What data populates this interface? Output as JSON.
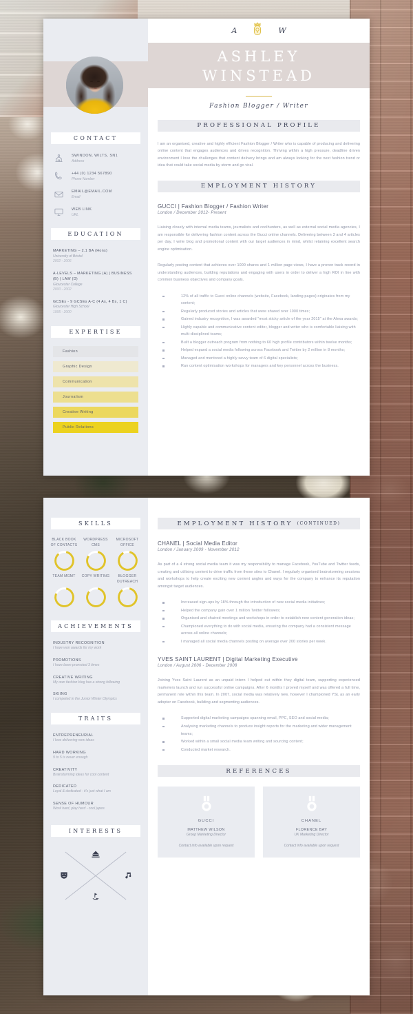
{
  "monogram": {
    "left_initial": "A",
    "right_initial": "W",
    "crest_color": "#e9c84a"
  },
  "header": {
    "first_name": "ASHLEY",
    "last_name": "WINSTEAD",
    "tagline": "Fashion Blogger / Writer",
    "band_color": "#ded6d4"
  },
  "sidebar": {
    "contact": {
      "heading": "CONTACT",
      "items": [
        {
          "icon": "location-icon",
          "value": "SWINDON, WILTS, SN1",
          "label": "Address"
        },
        {
          "icon": "phone-icon",
          "value": "+44 (0) 1234 567890",
          "label": "Phone Number"
        },
        {
          "icon": "email-icon",
          "value": "EMAIL@EMAIL.COM",
          "label": "Email"
        },
        {
          "icon": "monitor-icon",
          "value": "WEB LINK",
          "label": "URL"
        }
      ]
    },
    "education": {
      "heading": "EDUCATION",
      "items": [
        {
          "title": "MARKETING – 2.1 BA (Hons)",
          "school": "University of Bristol",
          "dates": "2002 - 2006"
        },
        {
          "title": "A-LEVELS – MARKETING (A) | BUSINESS (B) | LAW (D)",
          "school": "Gloucester College",
          "dates": "2000 - 2002"
        },
        {
          "title": "GCSEs - 9 GCSEs A-C (4 As, 4 Bs, 1 C)",
          "school": "Gloucester High School",
          "dates": "1995 - 2000"
        }
      ]
    },
    "expertise": {
      "heading": "EXPERTISE",
      "items": [
        {
          "label": "Fashion",
          "color": "#e4e5e8"
        },
        {
          "label": "Graphic Design",
          "color": "#efe9d0"
        },
        {
          "label": "Communication",
          "color": "#eee3ab"
        },
        {
          "label": "Journalism",
          "color": "#eddf8f"
        },
        {
          "label": "Creative Writing",
          "color": "#ecd85e"
        },
        {
          "label": "Public Relations",
          "color": "#ecd21f"
        }
      ]
    },
    "skills": {
      "heading": "SKILLS",
      "ring_color": "#e0c32a",
      "items": [
        {
          "label": "BLACK BOOK OF CONTACTS",
          "percent": 85
        },
        {
          "label": "WORDPRESS CMS",
          "percent": 80
        },
        {
          "label": "MICROSOFT OFFICE",
          "percent": 88
        },
        {
          "label": "TEAM MGMT",
          "percent": 78
        },
        {
          "label": "COPY WRITING",
          "percent": 82
        },
        {
          "label": "BLOGGER OUTREACH",
          "percent": 86
        }
      ]
    },
    "achievements": {
      "heading": "ACHIEVEMENTS",
      "items": [
        {
          "title": "INDUSTRY RECOGNITION",
          "desc": "I have won awards for my work"
        },
        {
          "title": "PROMOTIONS",
          "desc": "I have been promoted 3 times"
        },
        {
          "title": "CREATIVE WRITING",
          "desc": "My own fashion blog has a strong following"
        },
        {
          "title": "SKIING",
          "desc": "I competed in the Junior Winter Olympics"
        }
      ]
    },
    "traits": {
      "heading": "TRAITS",
      "items": [
        {
          "title": "ENTREPRENEURIAL",
          "desc": "I love delivering new ideas"
        },
        {
          "title": "HARD WORKING",
          "desc": "9 to 5 is never enough"
        },
        {
          "title": "CREATIVITY",
          "desc": "Brainstorming ideas for cool content"
        },
        {
          "title": "DEDICATED",
          "desc": "Loyal & dedicated - it's just what I am"
        },
        {
          "title": "SENSE OF HUMOUR",
          "desc": "Work hard, play hard - cool japes"
        }
      ]
    },
    "interests": {
      "heading": "INTERESTS",
      "icons": [
        "piano-icon",
        "theatre-mask-icon",
        "music-note-icon",
        "golf-icon"
      ]
    }
  },
  "main": {
    "profile": {
      "heading": "PROFESSIONAL PROFILE",
      "text": "I am an organised, creative and highly efficient Fashion Blogger / Writer who is capable of producing and delivering online content that engages audiences and drives recognition. Thriving within a high pressure, deadline driven environment I love the challenges that content delivery brings and am always looking for the next fashion trend or idea that could take social media by storm and go viral."
    },
    "employment": {
      "heading": "EMPLOYMENT HISTORY",
      "heading_continued": "EMPLOYMENT HISTORY",
      "continued_suffix": "(CONTINUED)",
      "jobs": [
        {
          "title": "GUCCI | Fashion Blogger / Fashion Writer",
          "meta": "London / December 2012- Present",
          "paragraphs": [
            "Liaising closely with internal media teams, journalists and coolhunters, as well as external social media agencies, I am responsible for delivering fashion content across the Gucci online channels.  Delivering between 3 and 4 articles per day, I write blog and promotional content with our target audiences in mind, whilst retaining excellent search engine optimisation.",
            "Regularly posting content that achieves over 1000 shares and 1 million page views, I have a proven track record in understanding audiences, building reputations and engaging with users in order to deliver a high ROI in line with common business objectives and company goals."
          ],
          "bullets": [
            "12% of all traffic to Gucci online channels (website, Facebook, landing pages) originates from my content;",
            "Regularly produced stories and articles that were shared over 1000 times;",
            "Gained industry recognition, I was awarded \"most sticky article of the year 2015\" at the Alexa awards;",
            "Highly capable and communicative content editor, blogger and writer  who is comfortable liaising with multi-disciplined teams;",
            "Built a blogger outreach program from nothing to 60 high profile contributors within twelve months;",
            "Helped expand a social media following across Facebook and Twitter by 2 million in 8 months;",
            "Managed and mentored a highly savvy team of 6 digital specialists;",
            "Ran content optimisation workshops for managers and key personnel across the business."
          ]
        },
        {
          "title": "CHANEL | Social Media Editor",
          "meta": "London / January 2009 - November 2012",
          "paragraphs": [
            "As part of a 4 strong social media team it was my responsibility to manage Facebook, YouTube and Twitter feeds, creating and utilising content to drive traffic from these sites to Chanel.  I regularly organised brainstorming sessions and workshops to help create exciting new content angles and ways for the company to enhance its reputation amongst target audiences."
          ],
          "bullets": [
            "Increased sign-ups by 18% through the introduction of new  social media initiatives;",
            "Helped the company gain over 1 million Twitter followers;",
            "Organised and chaired meetings and workshops in order to establish new content generation ideas;",
            "Championed everything to do with social media, ensuring the company had a consistent message across all online channels;",
            "I managed all social media channels posting on average over 200 stories per week."
          ]
        },
        {
          "title": "YVES SAINT LAURENT | Digital Marketing Executive",
          "meta": "London / August 2006 - December 2008",
          "paragraphs": [
            "Joining Yves Saint Laurent as an unpaid intern I helped out within they digital team, supporting experienced marketers launch and run successful online campaigns.  After 6 months I proved myself and was offered a full time, permanent role within this team.   In 2007, social media was relatively new, however I championed YSL as an early adopter on Facebook, building and segmenting audiences."
          ],
          "bullets": [
            "Supported digital marketing campaigns spanning email, PPC, SEO and social media;",
            "Analysing marketing channels to produce insight reports for the marketing and wider management teams;",
            "Worked within a small social media team writing and sourcing content;",
            "Conducted market research."
          ]
        }
      ]
    },
    "references": {
      "heading": "REFERENCES",
      "items": [
        {
          "company": "GUCCI",
          "name": "MATTHEW WILSON",
          "title": "Group Marketing Director",
          "note": "Contact info available upon request"
        },
        {
          "company": "CHANEL",
          "name": "FLORENCE BAY",
          "title": "UK Marketing Director",
          "note": "Contact info available upon request"
        }
      ]
    }
  }
}
